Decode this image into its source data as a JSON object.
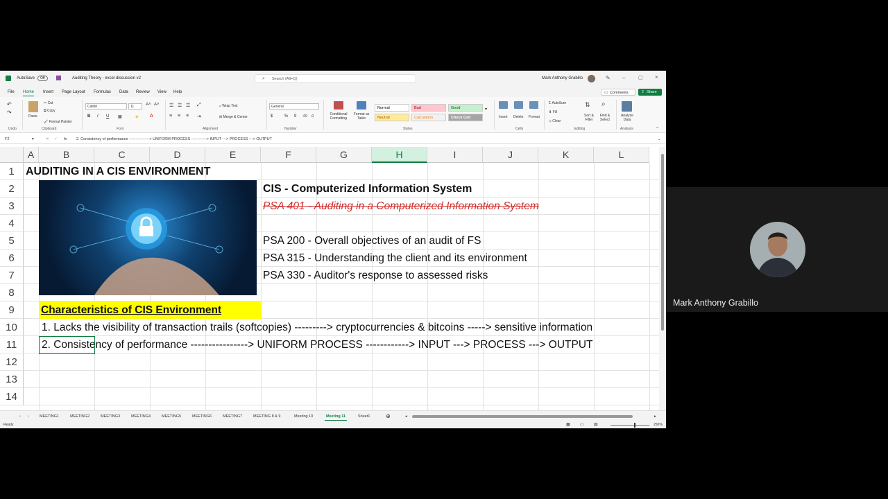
{
  "titlebar": {
    "autosave_label": "AutoSave",
    "autosave_state": "Off",
    "doc_title": "Auditing Theory - excel discussion v2",
    "search_placeholder": "Search (Alt+Q)",
    "user_name": "Mark Anthony Grabillo"
  },
  "menu": {
    "tabs": [
      "File",
      "Home",
      "Insert",
      "Page Layout",
      "Formulas",
      "Data",
      "Review",
      "View",
      "Help"
    ],
    "active": "Home",
    "comments_label": "Comments",
    "share_label": "Share"
  },
  "ribbon": {
    "undo_group": "Undo",
    "paste": "Paste",
    "cut": "Cut",
    "copy": "Copy",
    "format_painter": "Format Painter",
    "clipboard_group": "Clipboard",
    "font_name": "Calibri",
    "font_size": "11",
    "font_group": "Font",
    "wrap_text": "Wrap Text",
    "merge_center": "Merge & Center",
    "alignment_group": "Alignment",
    "number_format": "General",
    "number_group": "Number",
    "conditional_formatting": "Conditional Formatting",
    "format_as_table": "Format as Table",
    "styles": [
      {
        "label": "Normal",
        "bg": "#ffffff",
        "color": "#000000"
      },
      {
        "label": "Bad",
        "bg": "#ffc7ce",
        "color": "#9c0006"
      },
      {
        "label": "Good",
        "bg": "#c6efce",
        "color": "#006100"
      },
      {
        "label": "Neutral",
        "bg": "#ffeb9c",
        "color": "#9c5700"
      },
      {
        "label": "Calculation",
        "bg": "#f2f2f2",
        "color": "#fa7d00"
      },
      {
        "label": "Check Cell",
        "bg": "#a5a5a5",
        "color": "#ffffff"
      }
    ],
    "styles_group": "Styles",
    "insert": "Insert",
    "delete": "Delete",
    "format": "Format",
    "cells_group": "Cells",
    "autosum": "AutoSum",
    "fill": "Fill",
    "clear": "Clear",
    "sort_filter": "Sort & Filter",
    "find_select": "Find & Select",
    "editing_group": "Editing",
    "analyze_data": "Analyze Data",
    "analysis_group": "Analysis"
  },
  "formulabar": {
    "name_box": "F2",
    "fx": "fx",
    "content": "2. Consistency of performance ----------------> UNIFORM PROCESS ------------> INPUT ---> PROCESS ---> OUTPUT"
  },
  "grid": {
    "columns": [
      "A",
      "B",
      "C",
      "D",
      "E",
      "F",
      "G",
      "H",
      "I",
      "J",
      "K",
      "L"
    ],
    "selected_column": "H",
    "rows": [
      "1",
      "2",
      "3",
      "4",
      "5",
      "6",
      "7",
      "8",
      "9",
      "10",
      "11",
      "12",
      "13",
      "14"
    ],
    "cells": {
      "a1": "AUDITING IN A CIS ENVIRONMENT",
      "f2": "CIS - Computerized Information System",
      "f3": "PSA 401 - Auditing in a Computerized Information System",
      "f5": "PSA 200 - Overall objectives of an audit of FS",
      "f6": "PSA 315 - Understanding the client and its environment",
      "f7": "PSA 330 - Auditor's response to assessed risks",
      "b9": "Characteristics of CIS Environment",
      "b10": "1. Lacks the visibility of transaction trails (softcopies) ---------> cryptocurrencies & bitcoins -----> sensitive information",
      "b11": "2. Consistency of performance ----------------> UNIFORM PROCESS ------------> INPUT ---> PROCESS ---> OUTPUT"
    },
    "image_alt_icon": "padlock-icon"
  },
  "sheets": {
    "tabs": [
      "MEETING1",
      "MEETING2",
      "MEETING3",
      "MEETING4",
      "MEETING5",
      "MEETING6",
      "MEETING7",
      "MEETING 8 & 9",
      "Meeting 10",
      "Meeting 11",
      "Sheet1"
    ],
    "active": "Meeting 11"
  },
  "status": {
    "ready": "Ready",
    "zoom": "250%"
  },
  "participant": {
    "name": "Mark Anthony Grabillo"
  }
}
